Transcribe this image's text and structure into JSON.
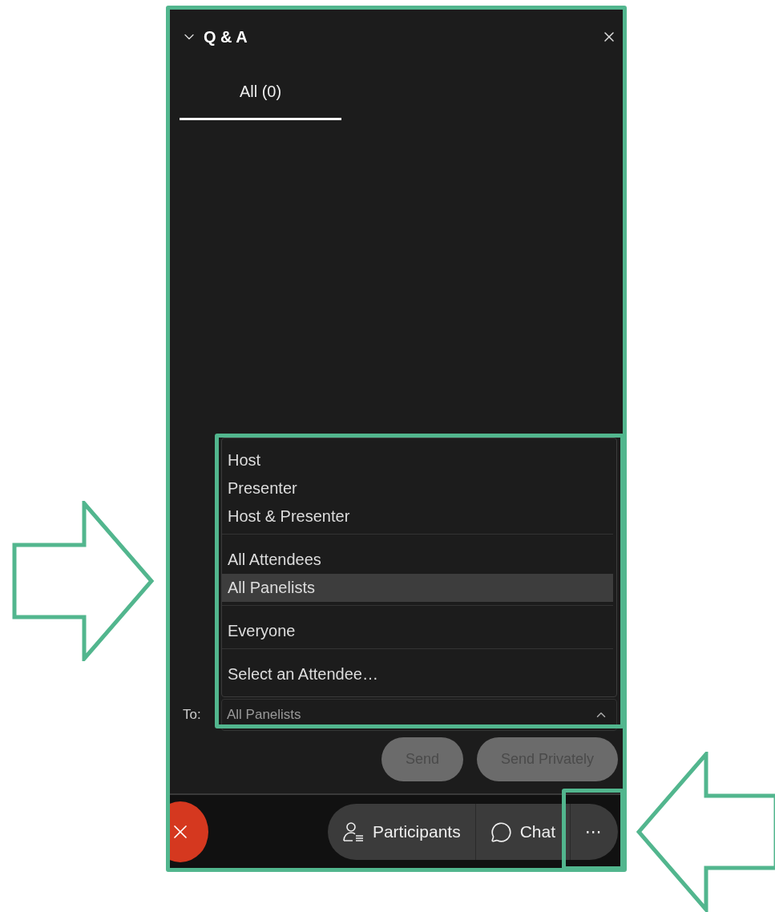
{
  "panel": {
    "title": "Q & A",
    "expanded": true
  },
  "tabs": [
    {
      "label": "All (0)",
      "selected": true
    }
  ],
  "recipient_menu": {
    "groups": [
      [
        {
          "label": "Host",
          "selected": false
        },
        {
          "label": "Presenter",
          "selected": false
        },
        {
          "label": "Host & Presenter",
          "selected": false
        }
      ],
      [
        {
          "label": "All Attendees",
          "selected": false
        },
        {
          "label": "All Panelists",
          "selected": true
        }
      ],
      [
        {
          "label": "Everyone",
          "selected": false
        }
      ],
      [
        {
          "label": "Select an Attendee…",
          "selected": false
        }
      ]
    ]
  },
  "to_field": {
    "label": "To:",
    "value": "All Panelists",
    "expanded": true
  },
  "send_buttons": [
    {
      "label": "Send",
      "disabled": true
    },
    {
      "label": "Send Privately",
      "disabled": true
    }
  ],
  "toolbar": [
    {
      "kind": "participants",
      "label": "Participants"
    },
    {
      "kind": "chat",
      "label": "Chat"
    },
    {
      "kind": "more",
      "label": "⋯"
    }
  ],
  "callouts": [
    {
      "kind": "right"
    },
    {
      "kind": "left"
    }
  ]
}
